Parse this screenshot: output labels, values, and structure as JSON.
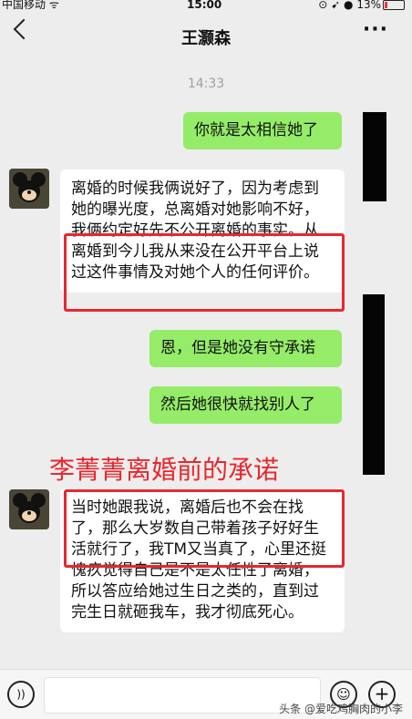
{
  "status": {
    "carrier": "中国移动",
    "time": "15:00",
    "battery": "13%"
  },
  "header": {
    "title": "王灏森",
    "more": "···"
  },
  "timestamp": "14:33",
  "messages": {
    "m1": "你就是太相信她了",
    "m2": "离婚的时候我俩说好了，因为考虑到她的曝光度，总离婚对她影响不好，我俩约定好先不公开离婚的事实。从离婚到今儿我从来没在公开平台上说过这件事情及对她个人的任何评价。",
    "m3": "恩，但是她没有守承诺",
    "m4": "然后她很快就找别人了",
    "m5": "当时她跟我说，离婚后也不会在找了，那么大岁数自己带着孩子好好生活就行了，我TM又当真了，心里还挺愧疚觉得自己是不是太任性了离婚，所以答应给她过生日之类的，直到过完生日就砸我车，我才彻底死心。"
  },
  "caption": "李菁菁离婚前的承诺",
  "watermark": "头条 @爱吃鸡胸肉的小李",
  "colors": {
    "accent": "#e8272d",
    "outgoing": "#95ec69",
    "incoming": "#ffffff"
  }
}
